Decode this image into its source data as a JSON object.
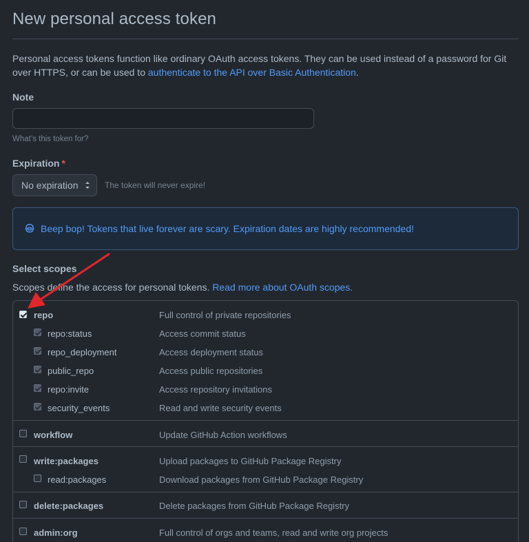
{
  "page": {
    "title": "New personal access token"
  },
  "intro": {
    "text_before_link": "Personal access tokens function like ordinary OAuth access tokens. They can be used instead of a password for Git over HTTPS, or can be used to ",
    "link_text": "authenticate to the API over Basic Authentication",
    "text_after_link": "."
  },
  "note": {
    "label": "Note",
    "value": "",
    "placeholder": "",
    "hint": "What’s this token for?"
  },
  "expiration": {
    "label": "Expiration",
    "required_marker": "*",
    "selected": "No expiration",
    "hint": "The token will never expire!"
  },
  "flash": {
    "icon": "copilot-bot-icon",
    "message": "Beep bop! Tokens that live forever are scary. Expiration dates are highly recommended!"
  },
  "scopes": {
    "title": "Select scopes",
    "desc_before_link": "Scopes define the access for personal tokens. ",
    "desc_link": "Read more about OAuth scopes.",
    "groups": [
      {
        "name": "repo",
        "description": "Full control of private repositories",
        "checked": true,
        "children": [
          {
            "name": "repo:status",
            "description": "Access commit status",
            "checked": true
          },
          {
            "name": "repo_deployment",
            "description": "Access deployment status",
            "checked": true
          },
          {
            "name": "public_repo",
            "description": "Access public repositories",
            "checked": true
          },
          {
            "name": "repo:invite",
            "description": "Access repository invitations",
            "checked": true
          },
          {
            "name": "security_events",
            "description": "Read and write security events",
            "checked": true
          }
        ]
      },
      {
        "name": "workflow",
        "description": "Update GitHub Action workflows",
        "checked": false,
        "children": []
      },
      {
        "name": "write:packages",
        "description": "Upload packages to GitHub Package Registry",
        "checked": false,
        "children": [
          {
            "name": "read:packages",
            "description": "Download packages from GitHub Package Registry",
            "checked": false
          }
        ]
      },
      {
        "name": "delete:packages",
        "description": "Delete packages from GitHub Package Registry",
        "checked": false,
        "children": []
      },
      {
        "name": "admin:org",
        "description": "Full control of orgs and teams, read and write org projects",
        "checked": false,
        "children": []
      }
    ]
  },
  "annotation": {
    "color": "#e3262b",
    "icon": "red-arrow-pointer"
  },
  "colors": {
    "background": "#22272e",
    "link": "#539bf5",
    "required": "#e5534b",
    "border": "#444c56"
  }
}
